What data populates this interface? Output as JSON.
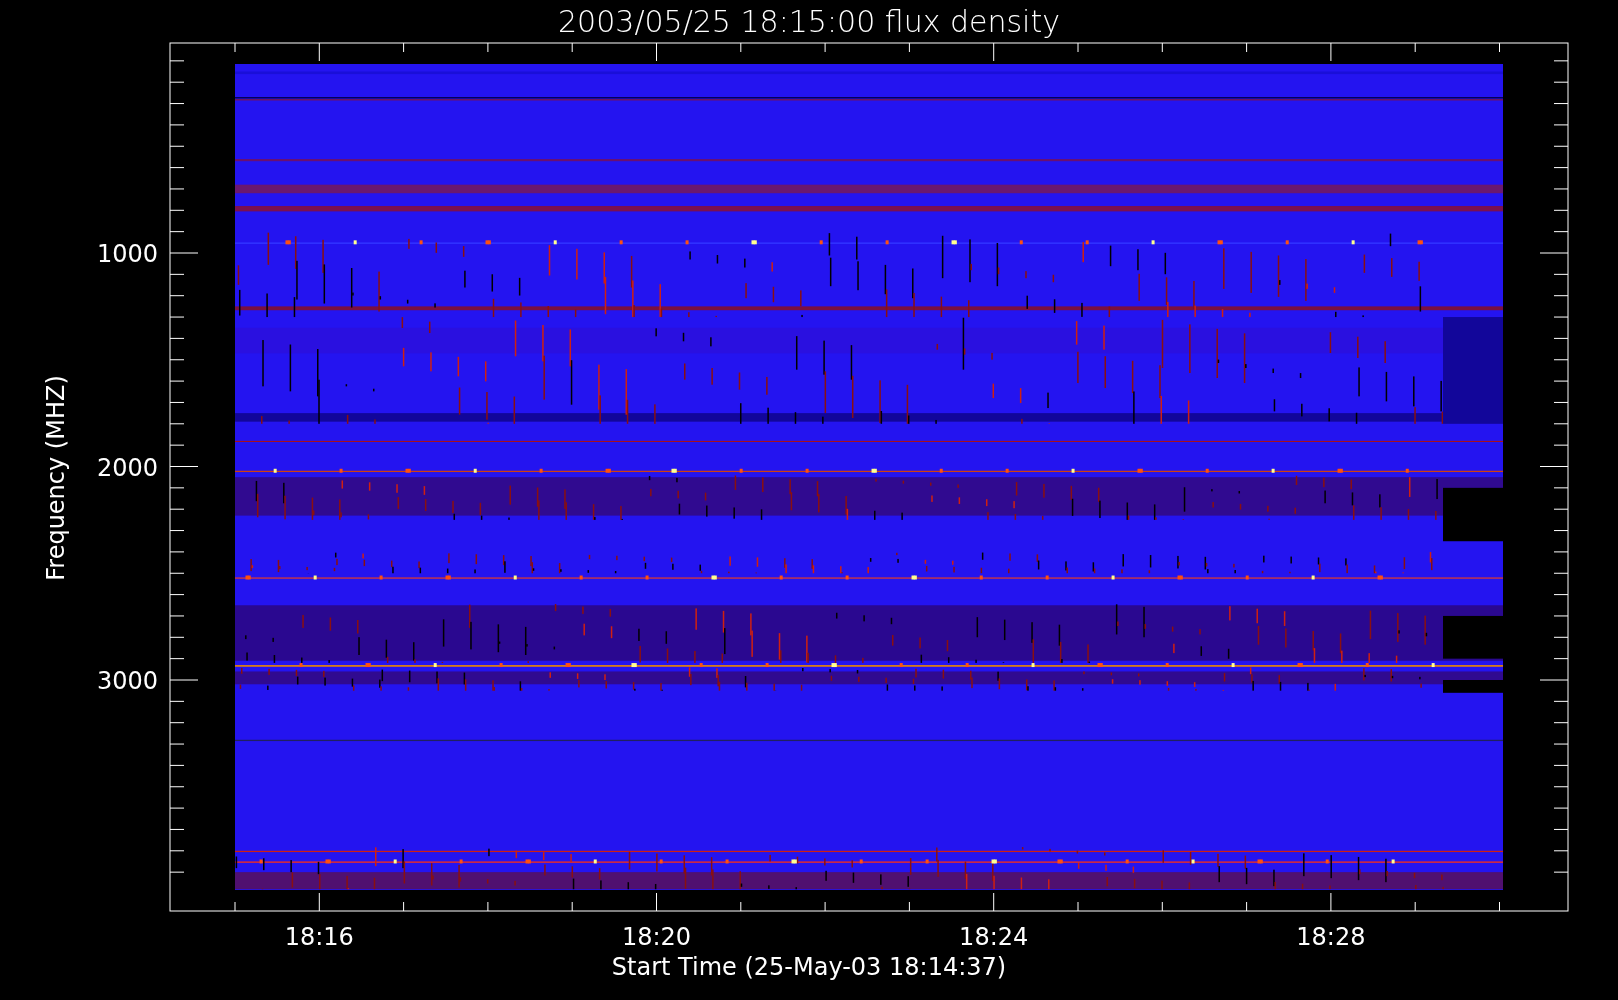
{
  "title": "2003/05/25 18:15:00 flux density",
  "x_axis": {
    "label": "Start Time (25-May-03 18:14:37)",
    "ticks": [
      "18:16",
      "18:20",
      "18:24",
      "18:28"
    ]
  },
  "y_axis": {
    "label": "Frequency (MHZ)",
    "ticks": [
      "1000",
      "2000",
      "3000"
    ]
  }
}
